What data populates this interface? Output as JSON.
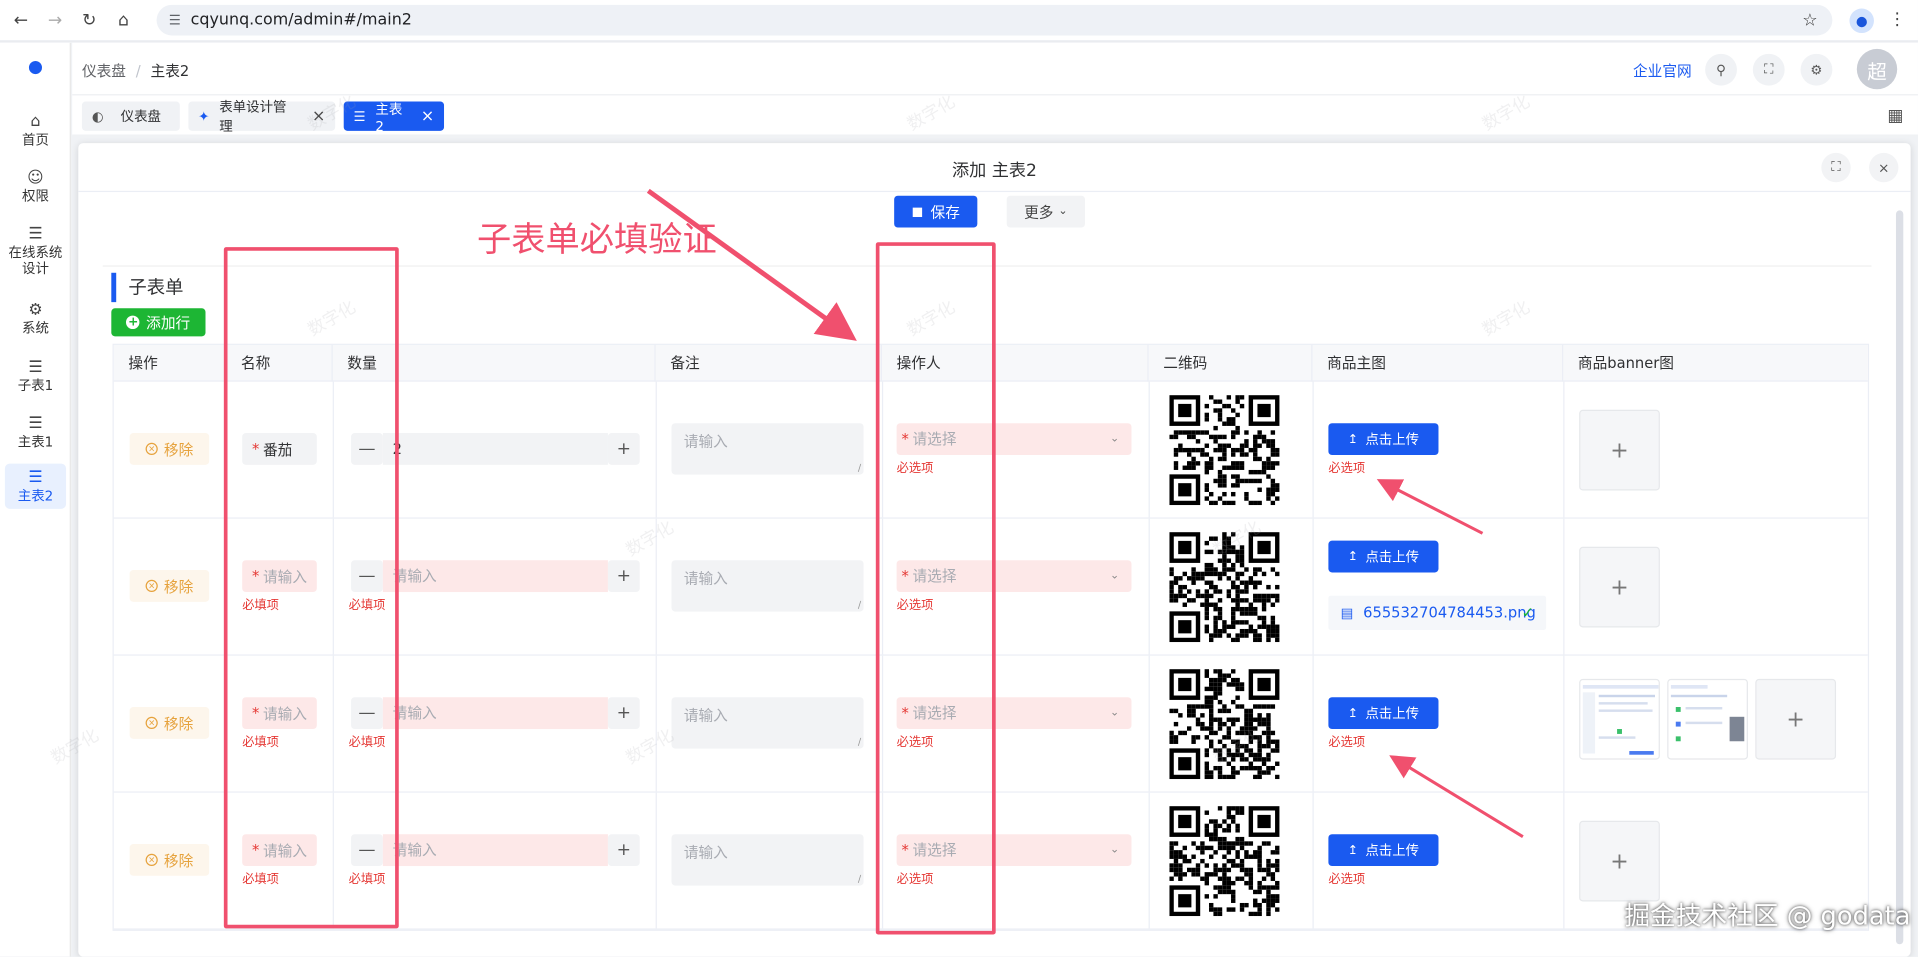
{
  "browser": {
    "url": "cqyunq.com/admin#/main2"
  },
  "breadcrumb": {
    "home": "仪表盘",
    "current": "主表2"
  },
  "header": {
    "official_site": "企业官网",
    "avatar_text": "超"
  },
  "sidebar": {
    "items": [
      {
        "label": "首页",
        "icon": "home-icon"
      },
      {
        "label": "权限",
        "icon": "user-lock-icon"
      },
      {
        "label": "在线系统设计",
        "icon": "layers-icon"
      },
      {
        "label": "系统",
        "icon": "gear-icon"
      },
      {
        "label": "子表1",
        "icon": "list-icon"
      },
      {
        "label": "主表1",
        "icon": "list-icon"
      },
      {
        "label": "主表2",
        "icon": "list-icon"
      }
    ]
  },
  "tabs": [
    {
      "label": "仪表盘",
      "closable": false
    },
    {
      "label": "表单设计管理",
      "closable": true
    },
    {
      "label": "主表2",
      "closable": true,
      "active": true
    }
  ],
  "dialog": {
    "title": "添加 主表2",
    "save_label": "保存",
    "more_label": "更多"
  },
  "subform": {
    "title": "子表单",
    "add_row_label": "添加行",
    "columns": [
      "操作",
      "名称",
      "数量",
      "备注",
      "操作人",
      "二维码",
      "商品主图",
      "商品banner图"
    ],
    "remove_label": "移除",
    "input_placeholder": "请输入",
    "select_placeholder": "请选择",
    "upload_label": "点击上传",
    "required_tip": "必填项",
    "required_tip_alt": "必选项",
    "rows": [
      {
        "name": "番茄",
        "quantity": "2",
        "uploaded_file": ""
      },
      {
        "name": "",
        "quantity": "",
        "uploaded_file": "655532704784453.png"
      },
      {
        "name": "",
        "quantity": "",
        "uploaded_file": ""
      },
      {
        "name": "",
        "quantity": "",
        "uploaded_file": ""
      }
    ]
  },
  "annotation": {
    "headline": "子表单必填验证"
  },
  "watermark": {
    "text": "数字化",
    "footer": "掘金技术社区 @ godata"
  },
  "colors": {
    "primary": "#1a5af0",
    "success": "#1db634",
    "warning": "#e6a23c",
    "danger": "#e53935",
    "annotation": "#f0506e"
  }
}
